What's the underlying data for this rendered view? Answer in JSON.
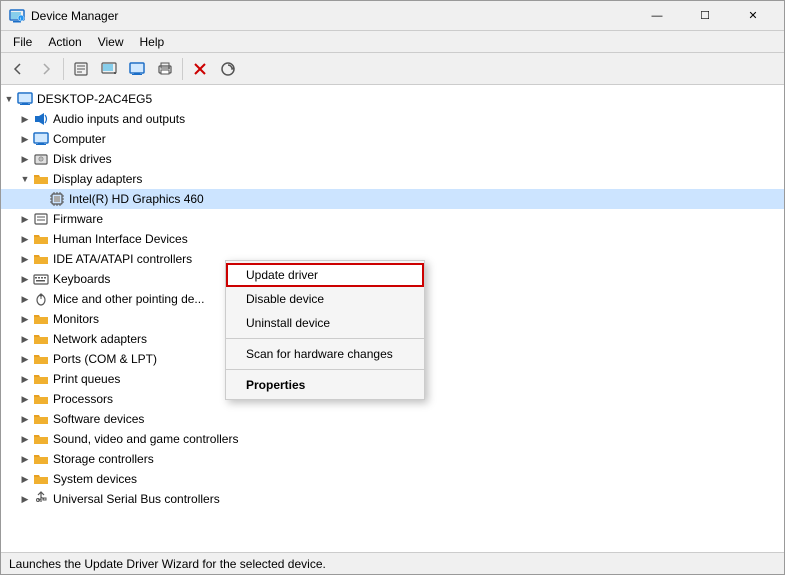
{
  "window": {
    "title": "Device Manager",
    "controls": {
      "minimize": "—",
      "maximize": "☐",
      "close": "✕"
    }
  },
  "menubar": {
    "items": [
      "File",
      "Action",
      "View",
      "Help"
    ]
  },
  "toolbar": {
    "buttons": [
      "←",
      "→",
      "⬆",
      "📋",
      "🔍",
      "💻",
      "🖨",
      "✖",
      "⬇"
    ]
  },
  "tree": {
    "root": "DESKTOP-2AC4EG5",
    "items": [
      {
        "id": "audio",
        "label": "Audio inputs and outputs",
        "indent": 1,
        "expanded": false,
        "icon": "sound"
      },
      {
        "id": "computer",
        "label": "Computer",
        "indent": 1,
        "expanded": false,
        "icon": "monitor"
      },
      {
        "id": "disk",
        "label": "Disk drives",
        "indent": 1,
        "expanded": false,
        "icon": "disk"
      },
      {
        "id": "display",
        "label": "Display adapters",
        "indent": 1,
        "expanded": true,
        "icon": "folder"
      },
      {
        "id": "intel",
        "label": "Intel(R) HD Graphics 460",
        "indent": 2,
        "expanded": false,
        "icon": "chip",
        "selected": true
      },
      {
        "id": "firmware",
        "label": "Firmware",
        "indent": 1,
        "expanded": false,
        "icon": "folder"
      },
      {
        "id": "hid",
        "label": "Human Interface Devices",
        "indent": 1,
        "expanded": false,
        "icon": "folder"
      },
      {
        "id": "ide",
        "label": "IDE ATA/ATAPI controllers",
        "indent": 1,
        "expanded": false,
        "icon": "folder"
      },
      {
        "id": "keyboards",
        "label": "Keyboards",
        "indent": 1,
        "expanded": false,
        "icon": "folder"
      },
      {
        "id": "mice",
        "label": "Mice and other pointing de...",
        "indent": 1,
        "expanded": false,
        "icon": "folder"
      },
      {
        "id": "monitors",
        "label": "Monitors",
        "indent": 1,
        "expanded": false,
        "icon": "folder"
      },
      {
        "id": "network",
        "label": "Network adapters",
        "indent": 1,
        "expanded": false,
        "icon": "folder"
      },
      {
        "id": "ports",
        "label": "Ports (COM & LPT)",
        "indent": 1,
        "expanded": false,
        "icon": "folder"
      },
      {
        "id": "print",
        "label": "Print queues",
        "indent": 1,
        "expanded": false,
        "icon": "folder"
      },
      {
        "id": "processors",
        "label": "Processors",
        "indent": 1,
        "expanded": false,
        "icon": "folder"
      },
      {
        "id": "software",
        "label": "Software devices",
        "indent": 1,
        "expanded": false,
        "icon": "folder"
      },
      {
        "id": "sound",
        "label": "Sound, video and game controllers",
        "indent": 1,
        "expanded": false,
        "icon": "folder"
      },
      {
        "id": "storage",
        "label": "Storage controllers",
        "indent": 1,
        "expanded": false,
        "icon": "folder"
      },
      {
        "id": "system",
        "label": "System devices",
        "indent": 1,
        "expanded": false,
        "icon": "folder"
      },
      {
        "id": "usb",
        "label": "Universal Serial Bus controllers",
        "indent": 1,
        "expanded": false,
        "icon": "usb"
      }
    ]
  },
  "context_menu": {
    "items": [
      {
        "id": "update",
        "label": "Update driver",
        "default": true,
        "highlighted": true
      },
      {
        "id": "disable",
        "label": "Disable device",
        "default": false
      },
      {
        "id": "uninstall",
        "label": "Uninstall device",
        "default": false
      },
      {
        "id": "sep1",
        "type": "separator"
      },
      {
        "id": "scan",
        "label": "Scan for hardware changes",
        "default": false
      },
      {
        "id": "sep2",
        "type": "separator"
      },
      {
        "id": "properties",
        "label": "Properties",
        "default": false,
        "bold": true
      }
    ]
  },
  "statusbar": {
    "text": "Launches the Update Driver Wizard for the selected device."
  }
}
